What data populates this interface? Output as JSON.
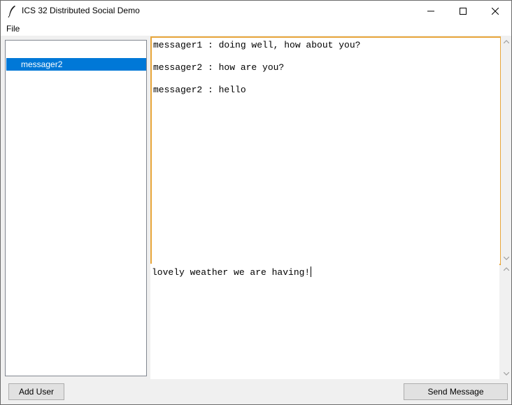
{
  "window": {
    "title": "ICS 32 Distributed Social Demo",
    "icon": "feather-icon"
  },
  "menu": {
    "items": [
      "File"
    ]
  },
  "users": {
    "items": [
      {
        "label": "messager2",
        "selected": true
      }
    ]
  },
  "messages": [
    "messager1 : doing well, how about you?",
    "messager2 : how are you?",
    "messager2 : hello"
  ],
  "compose": {
    "value": "lovely weather we are having!"
  },
  "buttons": {
    "add_user": "Add User",
    "send_message": "Send Message"
  },
  "colors": {
    "selection": "#0078d7",
    "focus_border": "#e8a63a"
  }
}
